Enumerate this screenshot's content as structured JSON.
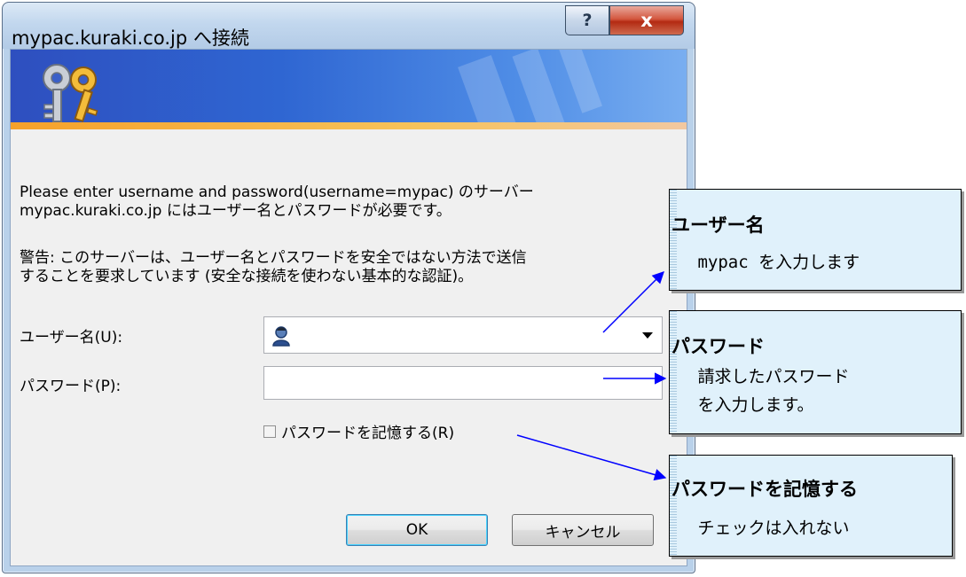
{
  "dialog": {
    "title": "mypac.kuraki.co.jp へ接続",
    "help_glyph": "?",
    "close_glyph": "x",
    "message": "Please enter username and password(username=mypac) のサーバー\nmypac.kuraki.co.jp にはユーザー名とパスワードが必要です。",
    "warning": "警告: このサーバーは、ユーザー名とパスワードを安全ではない方法で送信\nすることを要求しています (安全な接続を使わない基本的な認証)。",
    "username_label": "ユーザー名(U):",
    "username_value": "",
    "password_label": "パスワード(P):",
    "password_value": "",
    "remember_label": "パスワードを記憶する(R)",
    "remember_checked": false,
    "ok_label": "OK",
    "cancel_label": "キャンセル"
  },
  "callouts": [
    {
      "title": "ユーザー名",
      "text": " mypac を入力します"
    },
    {
      "title": "パスワード",
      "text": " 請求したパスワード\n を入力します。"
    },
    {
      "title": "パスワードを記憶する",
      "text": " チェックは入れない"
    }
  ],
  "colors": {
    "arrow": "#0000ff",
    "callout_bg": "#e0f1fb",
    "banner": "#2f66d2"
  },
  "icons": [
    "keys-icon",
    "user-icon",
    "help-icon",
    "close-icon",
    "dropdown-arrow-icon",
    "checkbox-icon"
  ]
}
